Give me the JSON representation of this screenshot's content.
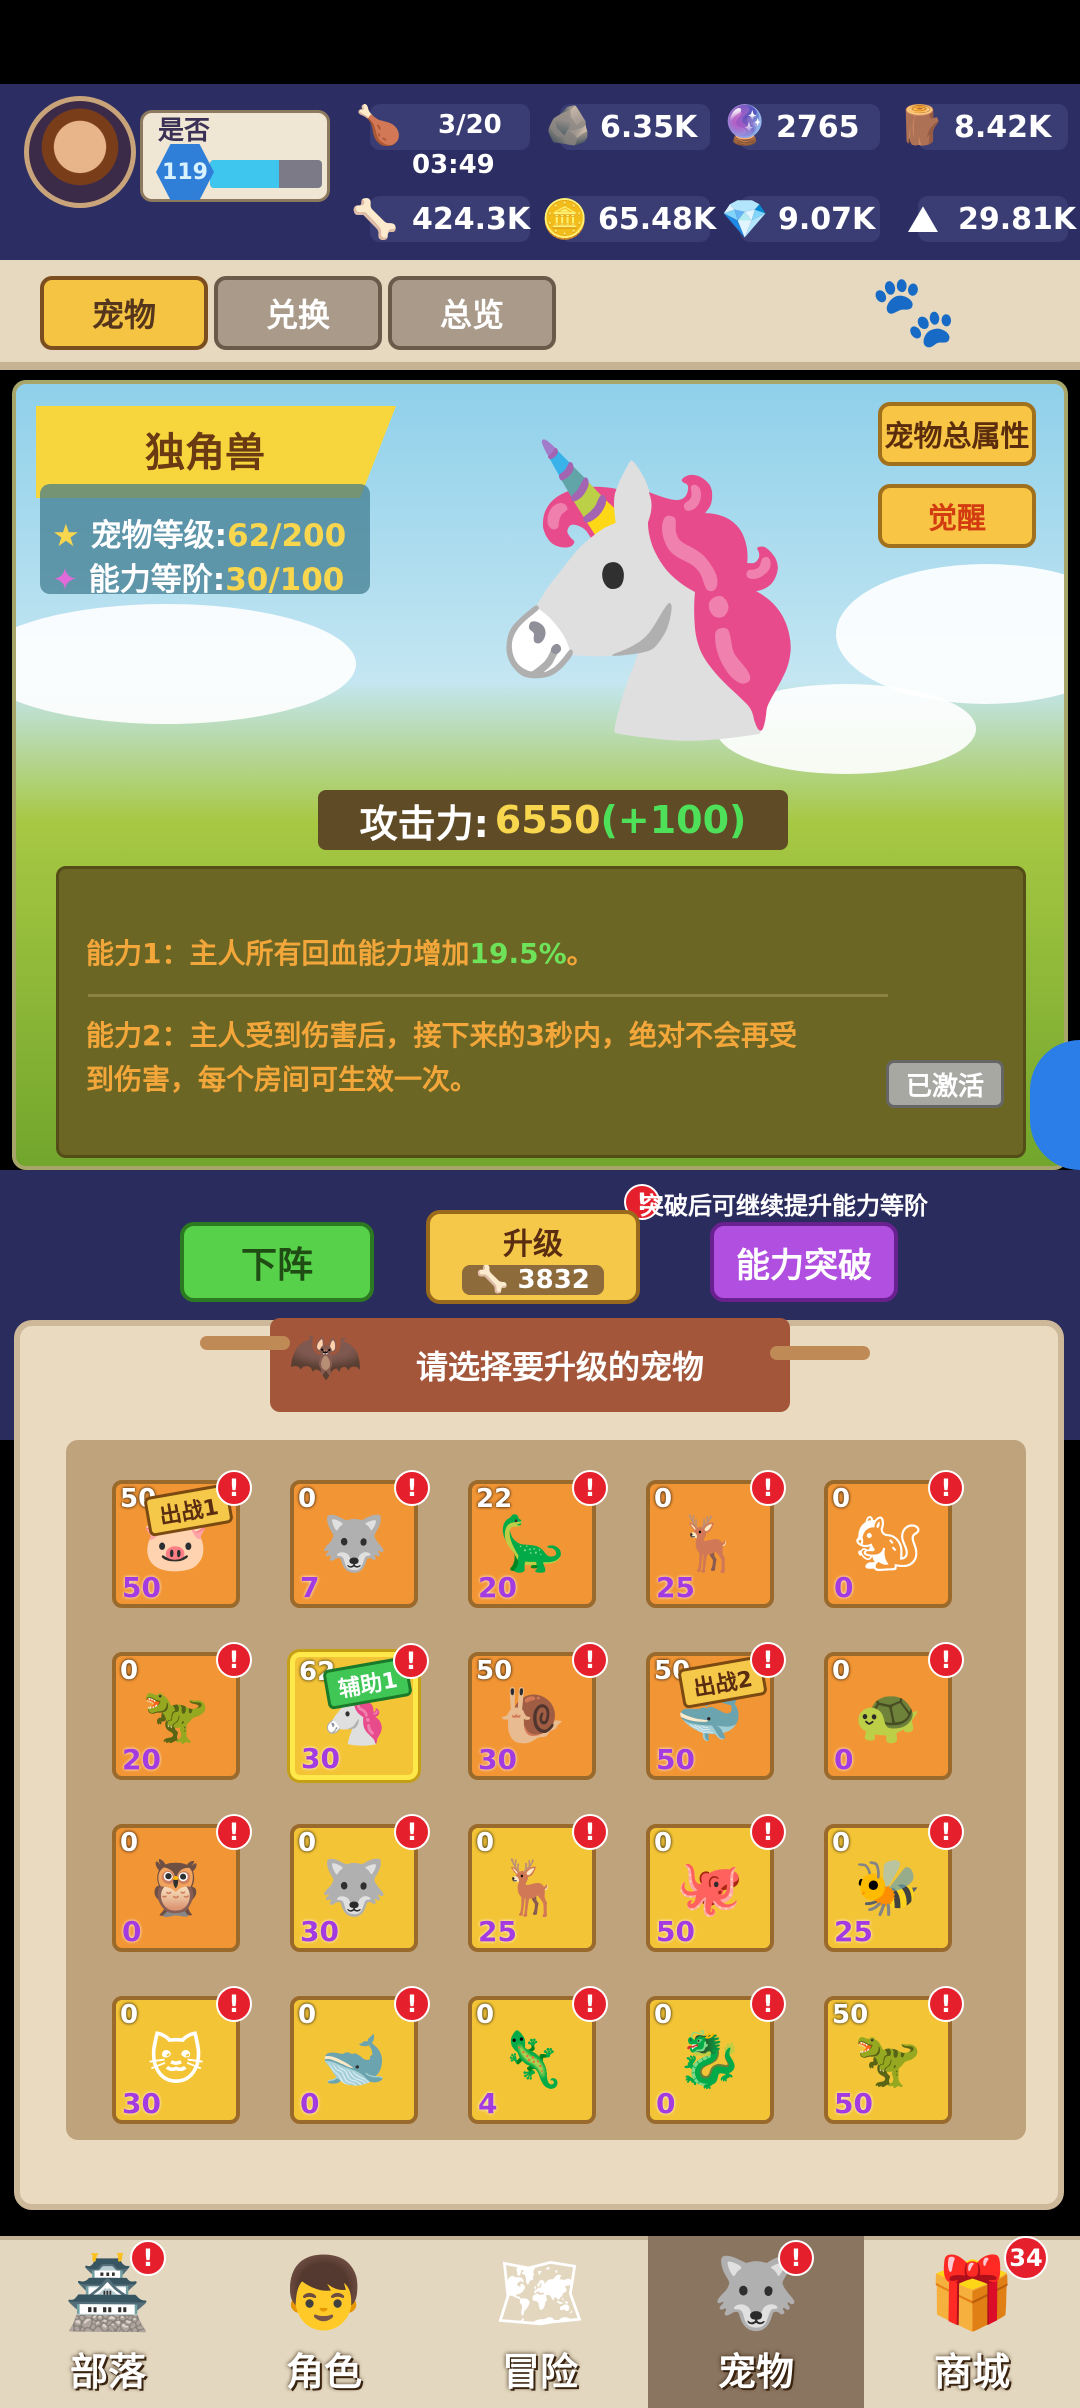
{
  "player": {
    "name": "是否",
    "level": "119",
    "xp_fraction": 0.62
  },
  "resources": {
    "stamina": {
      "value": "3/20",
      "timer": "03:49"
    },
    "stone_plus": "6.35K",
    "gem_purple": "2765",
    "wood": "8.42K",
    "bone": "424.3K",
    "coin": "65.48K",
    "crystal": "9.07K",
    "ore": "29.81K"
  },
  "tabs": [
    {
      "label": "宠物"
    },
    {
      "label": "兑换"
    },
    {
      "label": "总览"
    }
  ],
  "pet": {
    "name": "独角兽",
    "level_label": "宠物等级:",
    "level_value": "62/200",
    "tier_label": "能力等阶:",
    "tier_value": "30/100",
    "attack_label": "攻击力:",
    "attack_value": "6550",
    "attack_bonus": "(+100)",
    "total_attr_label": "宠物总属性",
    "awaken_label": "觉醒",
    "ability1_prefix": "能力1：主人所有回血能力增加",
    "ability1_value": "19.5%",
    "ability1_suffix": "。",
    "ability2_line1": "能力2：主人受到伤害后，接下来的3秒内，绝对不会再受",
    "ability2_line2": "到伤害，每个房间可生效一次。",
    "activated_label": "已激活"
  },
  "actions": {
    "hint": "突破后可继续提升能力等阶",
    "unequip": "下阵",
    "upgrade": "升级",
    "upgrade_cost": "3832",
    "breakthrough": "能力突破"
  },
  "select_title": "请选择要升级的宠物",
  "pets_grid": [
    {
      "top": "50",
      "bottom": "50",
      "tag": "出战1",
      "tag_style": "b",
      "color": "o",
      "icon": "🐷"
    },
    {
      "top": "0",
      "bottom": "7",
      "color": "o",
      "icon": "🐺"
    },
    {
      "top": "22",
      "bottom": "20",
      "color": "o",
      "icon": "🦕"
    },
    {
      "top": "0",
      "bottom": "25",
      "color": "o",
      "icon": "🦌"
    },
    {
      "top": "0",
      "bottom": "0",
      "color": "o",
      "icon": "🐿"
    },
    {
      "top": "0",
      "bottom": "20",
      "color": "o",
      "icon": "🦖"
    },
    {
      "top": "62",
      "bottom": "30",
      "tag": "辅助1",
      "tag_style": "gr",
      "color": "y",
      "selected": true,
      "icon": "🦄"
    },
    {
      "top": "50",
      "bottom": "30",
      "color": "o",
      "icon": "🐌"
    },
    {
      "top": "50",
      "bottom": "50",
      "tag": "出战2",
      "tag_style": "b",
      "color": "o",
      "icon": "🐳"
    },
    {
      "top": "0",
      "bottom": "0",
      "color": "o",
      "icon": "🐢"
    },
    {
      "top": "0",
      "bottom": "0",
      "color": "o",
      "icon": "🦉"
    },
    {
      "top": "0",
      "bottom": "30",
      "color": "y",
      "icon": "🐺"
    },
    {
      "top": "0",
      "bottom": "25",
      "color": "y",
      "icon": "🦌"
    },
    {
      "top": "0",
      "bottom": "50",
      "color": "y",
      "icon": "🐙"
    },
    {
      "top": "0",
      "bottom": "25",
      "color": "y",
      "icon": "🐝"
    },
    {
      "top": "0",
      "bottom": "30",
      "color": "y",
      "icon": "🐱"
    },
    {
      "top": "0",
      "bottom": "0",
      "color": "y",
      "icon": "🐋"
    },
    {
      "top": "0",
      "bottom": "4",
      "color": "y",
      "icon": "🦎"
    },
    {
      "top": "0",
      "bottom": "0",
      "color": "y",
      "icon": "🐉"
    },
    {
      "top": "50",
      "bottom": "50",
      "color": "y",
      "icon": "🦖"
    }
  ],
  "nav": [
    {
      "label": "部落",
      "icon": "🏯",
      "badge": "!"
    },
    {
      "label": "角色",
      "icon": "👦"
    },
    {
      "label": "冒险",
      "icon": "🗺"
    },
    {
      "label": "宠物",
      "icon": "🐺",
      "badge": "!",
      "active": true
    },
    {
      "label": "商城",
      "icon": "🎁",
      "count": "34"
    }
  ],
  "colors": {
    "accent": "#f5c443",
    "top_bg": "#2c2e63",
    "level_bar": "#3ec6ee",
    "badge": "#e5202c"
  }
}
